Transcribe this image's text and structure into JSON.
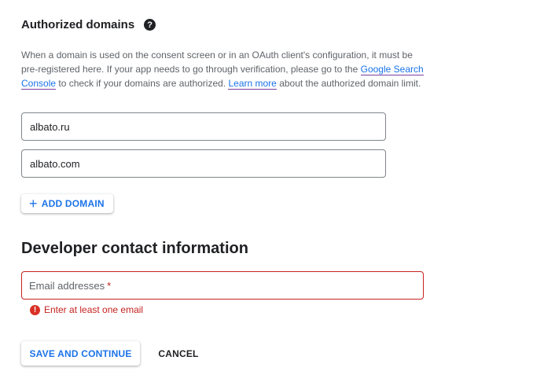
{
  "authorized_domains": {
    "title": "Authorized domains",
    "help_icon": "help-icon",
    "description": {
      "part1": "When a domain is used on the consent screen or in an OAuth client's configuration, it must be pre-registered here. If your app needs to go through verification, please go to the ",
      "link1": "Google Search Console",
      "part2": " to check if your domains are authorized. ",
      "link2": "Learn more",
      "part3": " about the authorized domain limit."
    },
    "domains": [
      "albato.ru",
      "albato.com"
    ],
    "add_button": {
      "icon": "plus-icon",
      "label": "ADD DOMAIN"
    }
  },
  "developer_contact": {
    "title": "Developer contact information",
    "email_field": {
      "placeholder": "Email addresses",
      "required_mark": "*"
    },
    "error": {
      "icon": "error-icon",
      "text": "Enter at least one email"
    }
  },
  "actions": {
    "save_label": "SAVE AND CONTINUE",
    "cancel_label": "CANCEL"
  },
  "colors": {
    "accent": "#1a73e8",
    "error": "#c5221f",
    "text": "#202124",
    "secondary_text": "#5f6368"
  }
}
